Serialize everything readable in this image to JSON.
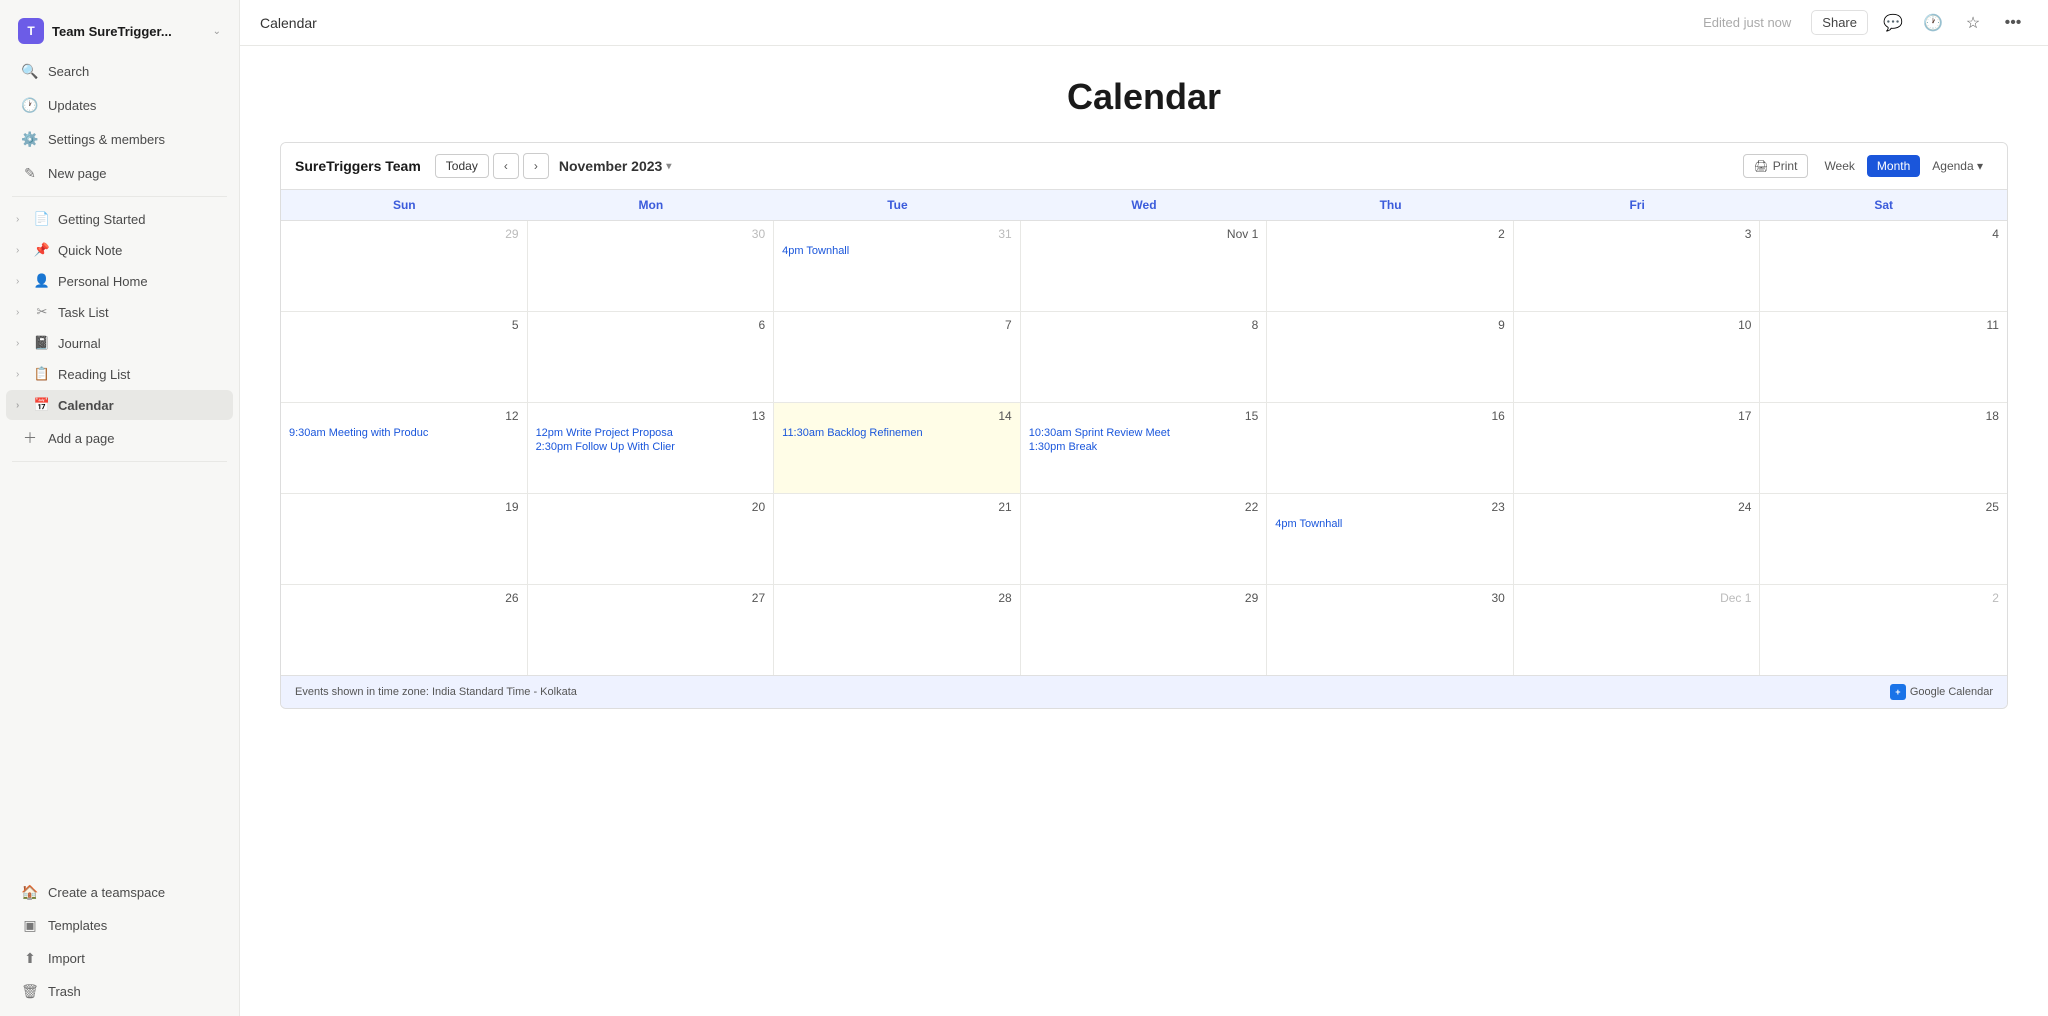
{
  "workspace": {
    "initial": "T",
    "name": "Team SureTrigger...",
    "chevron": "⌄"
  },
  "sidebar": {
    "search_label": "Search",
    "updates_label": "Updates",
    "settings_label": "Settings & members",
    "new_page_label": "New page",
    "nav_items": [
      {
        "id": "getting-started",
        "icon": "📄",
        "label": "Getting Started",
        "arrow": "›"
      },
      {
        "id": "quick-note",
        "icon": "📌",
        "label": "Quick Note",
        "arrow": "›"
      },
      {
        "id": "personal-home",
        "icon": "👤",
        "label": "Personal Home",
        "arrow": "›"
      },
      {
        "id": "task-list",
        "icon": "✂",
        "label": "Task List",
        "arrow": "›"
      },
      {
        "id": "journal",
        "icon": "📓",
        "label": "Journal",
        "arrow": "›"
      },
      {
        "id": "reading-list",
        "icon": "📋",
        "label": "Reading List",
        "arrow": "›"
      },
      {
        "id": "calendar",
        "icon": "📅",
        "label": "Calendar",
        "arrow": "›"
      }
    ],
    "add_page_label": "Add a page",
    "create_teamspace_label": "Create a teamspace",
    "templates_label": "Templates",
    "import_label": "Import",
    "trash_label": "Trash"
  },
  "topbar": {
    "title": "Calendar",
    "edited_label": "Edited just now",
    "share_label": "Share"
  },
  "page": {
    "title": "Calendar"
  },
  "calendar": {
    "team_name": "SureTriggers Team",
    "month_label": "November 2023",
    "today_btn": "Today",
    "views": [
      "Print",
      "Week",
      "Month",
      "Agenda"
    ],
    "active_view": "Month",
    "day_headers": [
      "Sun",
      "Mon",
      "Tue",
      "Wed",
      "Thu",
      "Fri",
      "Sat"
    ],
    "footer_timezone": "Events shown in time zone: India Standard Time - Kolkata",
    "google_cal_label": "Google Calendar",
    "weeks": [
      {
        "days": [
          {
            "date": "29",
            "other_month": true,
            "today": false,
            "events": []
          },
          {
            "date": "30",
            "other_month": true,
            "today": false,
            "events": []
          },
          {
            "date": "31",
            "other_month": true,
            "today": false,
            "events": [
              "4pm Townhall"
            ]
          },
          {
            "date": "Nov 1",
            "other_month": false,
            "today": false,
            "events": []
          },
          {
            "date": "2",
            "other_month": false,
            "today": false,
            "events": []
          },
          {
            "date": "3",
            "other_month": false,
            "today": false,
            "events": []
          },
          {
            "date": "4",
            "other_month": false,
            "today": false,
            "events": []
          }
        ]
      },
      {
        "days": [
          {
            "date": "5",
            "other_month": false,
            "today": false,
            "events": []
          },
          {
            "date": "6",
            "other_month": false,
            "today": false,
            "events": []
          },
          {
            "date": "7",
            "other_month": false,
            "today": false,
            "events": []
          },
          {
            "date": "8",
            "other_month": false,
            "today": false,
            "events": []
          },
          {
            "date": "9",
            "other_month": false,
            "today": false,
            "events": []
          },
          {
            "date": "10",
            "other_month": false,
            "today": false,
            "events": []
          },
          {
            "date": "11",
            "other_month": false,
            "today": false,
            "events": []
          }
        ]
      },
      {
        "days": [
          {
            "date": "12",
            "other_month": false,
            "today": false,
            "events": [
              "9:30am Meeting with Produc"
            ]
          },
          {
            "date": "13",
            "other_month": false,
            "today": false,
            "events": [
              "12pm Write Project Proposa",
              "2:30pm Follow Up With Clier"
            ]
          },
          {
            "date": "14",
            "other_month": false,
            "today": true,
            "events": [
              "11:30am Backlog Refinemen"
            ]
          },
          {
            "date": "15",
            "other_month": false,
            "today": false,
            "events": [
              "10:30am Sprint Review Meet",
              "1:30pm Break"
            ]
          },
          {
            "date": "16",
            "other_month": false,
            "today": false,
            "events": []
          },
          {
            "date": "17",
            "other_month": false,
            "today": false,
            "events": []
          },
          {
            "date": "18",
            "other_month": false,
            "today": false,
            "events": []
          }
        ]
      },
      {
        "days": [
          {
            "date": "19",
            "other_month": false,
            "today": false,
            "events": []
          },
          {
            "date": "20",
            "other_month": false,
            "today": false,
            "events": []
          },
          {
            "date": "21",
            "other_month": false,
            "today": false,
            "events": []
          },
          {
            "date": "22",
            "other_month": false,
            "today": false,
            "events": []
          },
          {
            "date": "23",
            "other_month": false,
            "today": false,
            "events": [
              "4pm Townhall"
            ]
          },
          {
            "date": "24",
            "other_month": false,
            "today": false,
            "events": []
          },
          {
            "date": "25",
            "other_month": false,
            "today": false,
            "events": []
          }
        ]
      },
      {
        "days": [
          {
            "date": "26",
            "other_month": false,
            "today": false,
            "events": []
          },
          {
            "date": "27",
            "other_month": false,
            "today": false,
            "events": []
          },
          {
            "date": "28",
            "other_month": false,
            "today": false,
            "events": []
          },
          {
            "date": "29",
            "other_month": false,
            "today": false,
            "events": []
          },
          {
            "date": "30",
            "other_month": false,
            "today": false,
            "events": []
          },
          {
            "date": "Dec 1",
            "other_month": true,
            "today": false,
            "events": []
          },
          {
            "date": "2",
            "other_month": true,
            "today": false,
            "events": []
          }
        ]
      }
    ]
  }
}
